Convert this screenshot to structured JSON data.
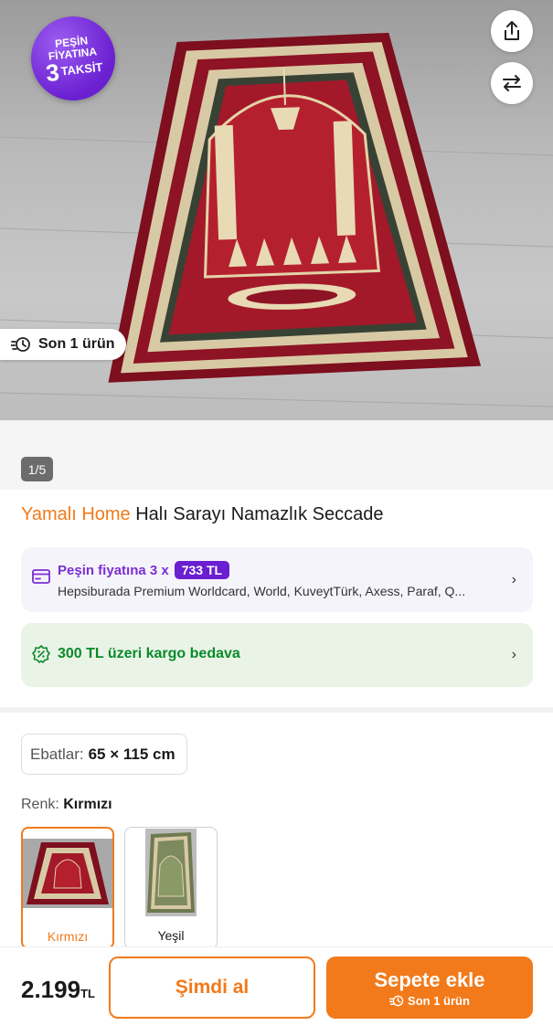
{
  "hero": {
    "badge": {
      "line1": "PEŞİN",
      "line2": "FİYATINA",
      "num": "3",
      "suffix": "TAKSİT"
    },
    "stock_pill": "Son 1 ürün",
    "image_counter": "1/5"
  },
  "product": {
    "brand": "Yamalı Home",
    "name": "Halı Sarayı Namazlık Seccade"
  },
  "installment": {
    "label": "Peşin fiyatına 3 x",
    "amount": "733 TL",
    "banks": "Hepsiburada Premium Worldcard, World, KuveytTürk, Axess, Paraf, Q..."
  },
  "cargo": {
    "label": "300 TL üzeri kargo bedava"
  },
  "size": {
    "label": "Ebatlar:",
    "value": "65 × 115 cm"
  },
  "color": {
    "label": "Renk:",
    "value": "Kırmızı",
    "options": [
      {
        "name": "Kırmızı",
        "selected": true,
        "hex": "#a3192a"
      },
      {
        "name": "Yeşil",
        "selected": false,
        "hex": "#7c8a5e"
      }
    ]
  },
  "bottom_bar": {
    "price": "2.199",
    "currency": "TL",
    "buy_now": "Şimdi al",
    "add_to_cart": "Sepete ekle",
    "add_to_cart_sub": "Son 1 ürün"
  },
  "colors": {
    "accent": "#f27a1a",
    "purple": "#6a1fd1",
    "green": "#0a8a2a"
  }
}
